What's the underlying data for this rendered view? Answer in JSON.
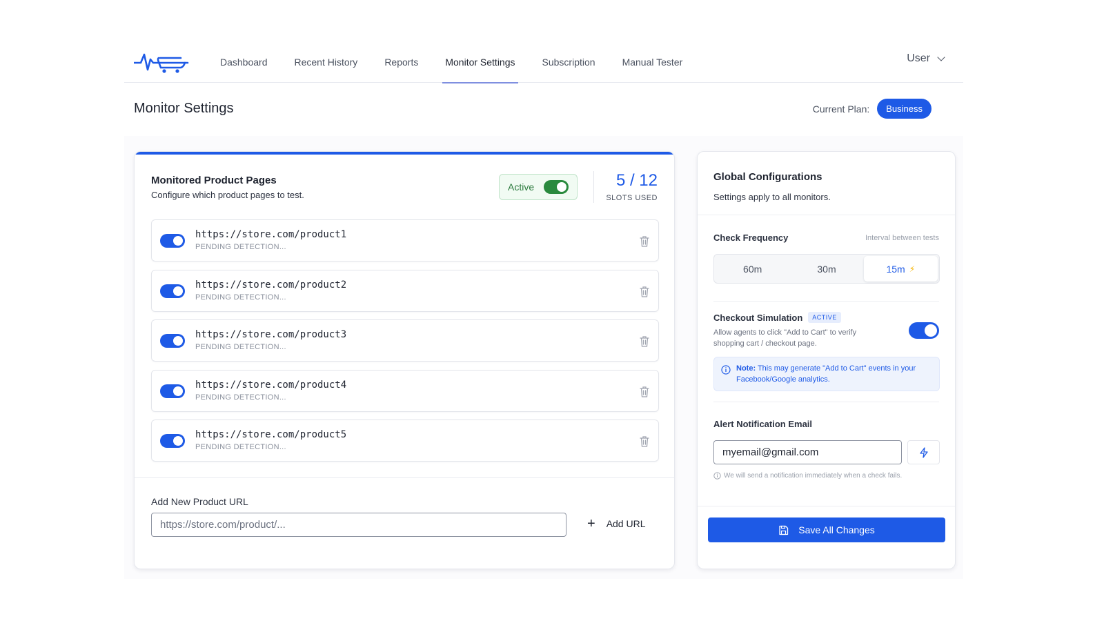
{
  "nav": {
    "tabs": [
      "Dashboard",
      "Recent History",
      "Reports",
      "Monitor Settings",
      "Subscription",
      "Manual Tester"
    ],
    "active_tab": "Monitor Settings",
    "user_label": "User"
  },
  "header": {
    "title": "Monitor Settings",
    "plan_label": "Current Plan:",
    "plan_value": "Business"
  },
  "monitored": {
    "title": "Monitored Product Pages",
    "subtitle": "Configure which product pages to test.",
    "active_label": "Active",
    "slots_count": "5 / 12",
    "slots_label": "SLOTS USED",
    "items": [
      {
        "url": "https://store.com/product1",
        "status": "PENDING DETECTION..."
      },
      {
        "url": "https://store.com/product2",
        "status": "PENDING DETECTION..."
      },
      {
        "url": "https://store.com/product3",
        "status": "PENDING DETECTION..."
      },
      {
        "url": "https://store.com/product4",
        "status": "PENDING DETECTION..."
      },
      {
        "url": "https://store.com/product5",
        "status": "PENDING DETECTION..."
      }
    ],
    "add_label": "Add New Product URL",
    "add_placeholder": "https://store.com/product/...",
    "add_button": "Add URL"
  },
  "global": {
    "title": "Global Configurations",
    "subtitle": "Settings apply to all monitors.",
    "frequency_label": "Check Frequency",
    "frequency_hint": "Interval between tests",
    "frequency_options": [
      "60m",
      "30m",
      "15m"
    ],
    "frequency_selected": "15m",
    "checkout_label": "Checkout Simulation",
    "checkout_badge": "ACTIVE",
    "checkout_desc": "Allow agents to click \"Add to Cart\" to verify shopping cart / checkout page.",
    "note_prefix": "Note:",
    "note_text": " This may generate \"Add to Cart\" events in your Facebook/Google analytics.",
    "email_label": "Alert Notification Email",
    "email_value": "myemail@gmail.com",
    "email_hint": "We will send a notification immediately when a check fails.",
    "save_button": "Save All Changes"
  },
  "colors": {
    "accent": "#1e5ae6",
    "active_green": "#2a8a3e",
    "bolt": "#f5b400"
  }
}
